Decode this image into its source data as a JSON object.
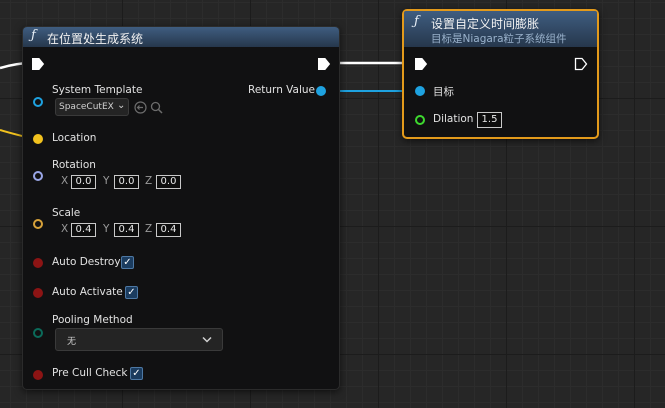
{
  "colors": {
    "node_header": "#3f5d80",
    "selection_outline": "#e39a1b",
    "object_pin": "#1ea2e0",
    "vector_pin": "#f2c21e",
    "rotator_pin": "#9aa6e6",
    "scale_pin": "#d7a23a",
    "bool_pin": "#8c1414",
    "enum_pin": "#0b6b5a",
    "float_pin": "#3ed92f",
    "exec_wire": "#ffffff",
    "object_wire": "#1ea2e0",
    "vector_wire": "#f2c21e"
  },
  "spawn_node": {
    "icon": "function-icon",
    "title": "在位置处生成系统",
    "return_value_label": "Return Value",
    "system_template": {
      "label": "System Template",
      "value": "SpaceCutEX",
      "icons": [
        "reset-arrow-icon",
        "search-icon"
      ]
    },
    "location_label": "Location",
    "rotation": {
      "label": "Rotation",
      "axes": [
        "X",
        "Y",
        "Z"
      ],
      "values": [
        "0.0",
        "0.0",
        "0.0"
      ]
    },
    "scale": {
      "label": "Scale",
      "axes": [
        "X",
        "Y",
        "Z"
      ],
      "values": [
        "0.4",
        "0.4",
        "0.4"
      ]
    },
    "auto_destroy": {
      "label": "Auto Destroy",
      "checked": true
    },
    "auto_activate": {
      "label": "Auto Activate",
      "checked": true
    },
    "pooling_method": {
      "label": "Pooling Method",
      "value": "无"
    },
    "pre_cull_check": {
      "label": "Pre Cull Check",
      "checked": true
    }
  },
  "dilation_node": {
    "icon": "function-icon",
    "title": "设置自定义时间膨胀",
    "subtitle": "目标是Niagara粒子系统组件",
    "target_label": "目标",
    "dilation_label": "Dilation",
    "dilation_value": "1.5",
    "selected": true
  }
}
